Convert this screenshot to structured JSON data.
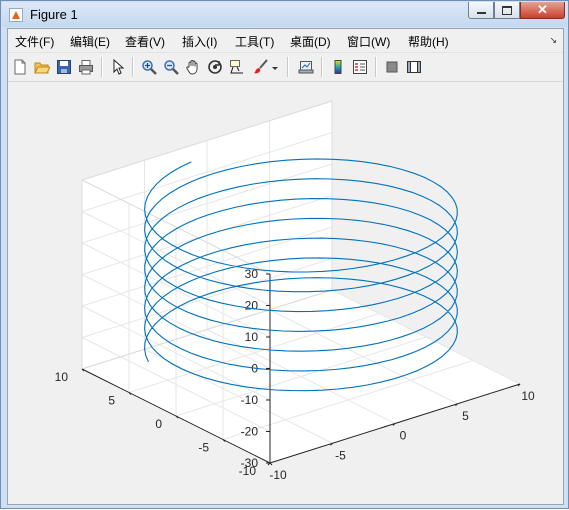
{
  "window": {
    "title": "Figure 1",
    "minimize_glyph": "",
    "maximize_glyph": "",
    "close_glyph": "✕"
  },
  "menu": [
    {
      "label": "文件(F)"
    },
    {
      "label": "编辑(E)"
    },
    {
      "label": "查看(V)"
    },
    {
      "label": "插入(I)"
    },
    {
      "label": "工具(T)"
    },
    {
      "label": "桌面(D)"
    },
    {
      "label": "窗口(W)"
    },
    {
      "label": "帮助(H)"
    }
  ],
  "menu_overflow_glyph": "↘",
  "toolbar": [
    {
      "icon": "new-figure-icon"
    },
    {
      "icon": "open-file-icon"
    },
    {
      "icon": "save-icon"
    },
    {
      "icon": "print-icon"
    },
    {
      "icon": "edit-plot-arrow-icon"
    },
    {
      "icon": "zoom-in-icon"
    },
    {
      "icon": "zoom-out-icon"
    },
    {
      "icon": "pan-hand-icon"
    },
    {
      "icon": "rotate-3d-icon"
    },
    {
      "icon": "data-cursor-icon"
    },
    {
      "icon": "brush-icon"
    },
    {
      "icon": "brush-dropdown-icon"
    },
    {
      "icon": "link-plot-icon"
    },
    {
      "icon": "insert-colorbar-icon"
    },
    {
      "icon": "insert-legend-icon"
    },
    {
      "icon": "hide-plot-tools-icon"
    },
    {
      "icon": "show-plot-tools-icon"
    }
  ],
  "chart_data": {
    "type": "line",
    "title": "",
    "xlabel": "",
    "ylabel": "",
    "zlabel": "",
    "xlim": [
      -10,
      10
    ],
    "ylim": [
      -10,
      10
    ],
    "zlim": [
      -30,
      30
    ],
    "x_ticks": [
      "-10",
      "-5",
      "0",
      "5",
      "10"
    ],
    "y_ticks": [
      "-10",
      "-5",
      "0",
      "5",
      "10"
    ],
    "z_ticks": [
      "-30",
      "-20",
      "-10",
      "0",
      "10",
      "20",
      "30"
    ],
    "grid": true,
    "view": "3-D view",
    "color": "#0072bd",
    "series": [
      {
        "kind": "helix",
        "x": "10*sin(t)",
        "y": "10*cos(t)",
        "z": "t",
        "t_range": [
          -20,
          25
        ]
      }
    ]
  }
}
